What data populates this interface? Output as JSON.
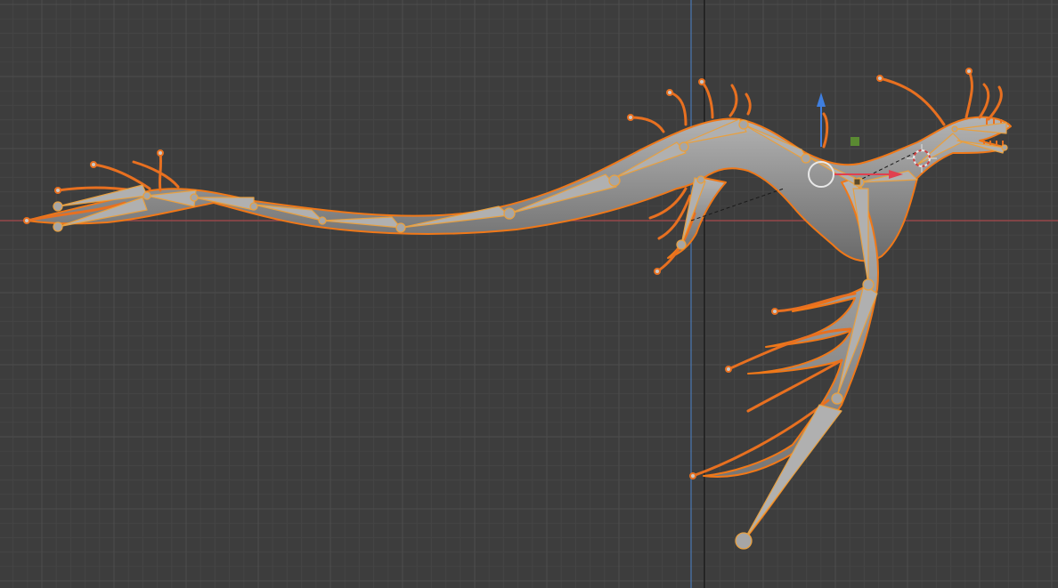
{
  "viewport": {
    "type": "3d-viewport",
    "colors": {
      "background": "#3d3d3d",
      "grid_minor": "#474747",
      "grid_major": "#4f4f4f",
      "axis_x": "#b34a4e",
      "axis_z": "#4a7ab8",
      "selection_outline": "#f07818",
      "bone": "#a8a8a8",
      "bone_edge": "#e8a040",
      "mesh": "#8e8e8e",
      "gizmo_z": "#3f7fe0",
      "gizmo_x": "#e04050",
      "gizmo_handle": "#5a8a32"
    },
    "icons": {
      "object_origin": "origin-dot-icon",
      "cursor_3d": "3d-cursor-icon",
      "rotate_gizmo": "rotate-gizmo-icon",
      "move_gizmo_z": "arrow-up-icon",
      "move_gizmo_x": "arrow-right-icon",
      "move_gizmo_plane": "square-handle-icon"
    }
  }
}
